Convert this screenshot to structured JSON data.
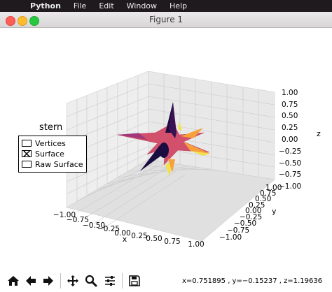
{
  "menubar": {
    "app": "Python",
    "items": [
      "File",
      "Edit",
      "Window",
      "Help"
    ]
  },
  "window": {
    "title": "Figure 1"
  },
  "plot": {
    "x_ticks": [
      "−1.00",
      "−0.75",
      "−0.50",
      "−0.25",
      "0.00",
      "0.25",
      "0.50",
      "0.75",
      "1.00"
    ],
    "y_ticks": [
      "−1.00",
      "−0.75",
      "−0.50",
      "−0.25",
      "0.00",
      "0.25",
      "0.50",
      "0.75",
      "1.00"
    ],
    "z_ticks": [
      "1.00",
      "0.75",
      "0.50",
      "0.25",
      "0.00",
      "−0.25",
      "−0.50",
      "−0.75",
      "−1.00"
    ],
    "x_label": "x",
    "y_label": "y",
    "z_label": "z",
    "surface_colors": {
      "main": "#d2506b",
      "dark": "#1b0c41",
      "orange": "#f6a13a",
      "yellow": "#f5e04b",
      "purple": "#7b2382"
    }
  },
  "legend": {
    "title": "stern",
    "items": [
      "Vertices",
      "Surface",
      "Raw Surface"
    ]
  },
  "toolbar": {
    "buttons": [
      "home-icon",
      "back-icon",
      "forward-icon",
      "pan-icon",
      "zoom-icon",
      "configure-subplots-icon",
      "save-icon"
    ],
    "coords": "x=0.751895    , y=−0.15237    , z=1.19636"
  }
}
